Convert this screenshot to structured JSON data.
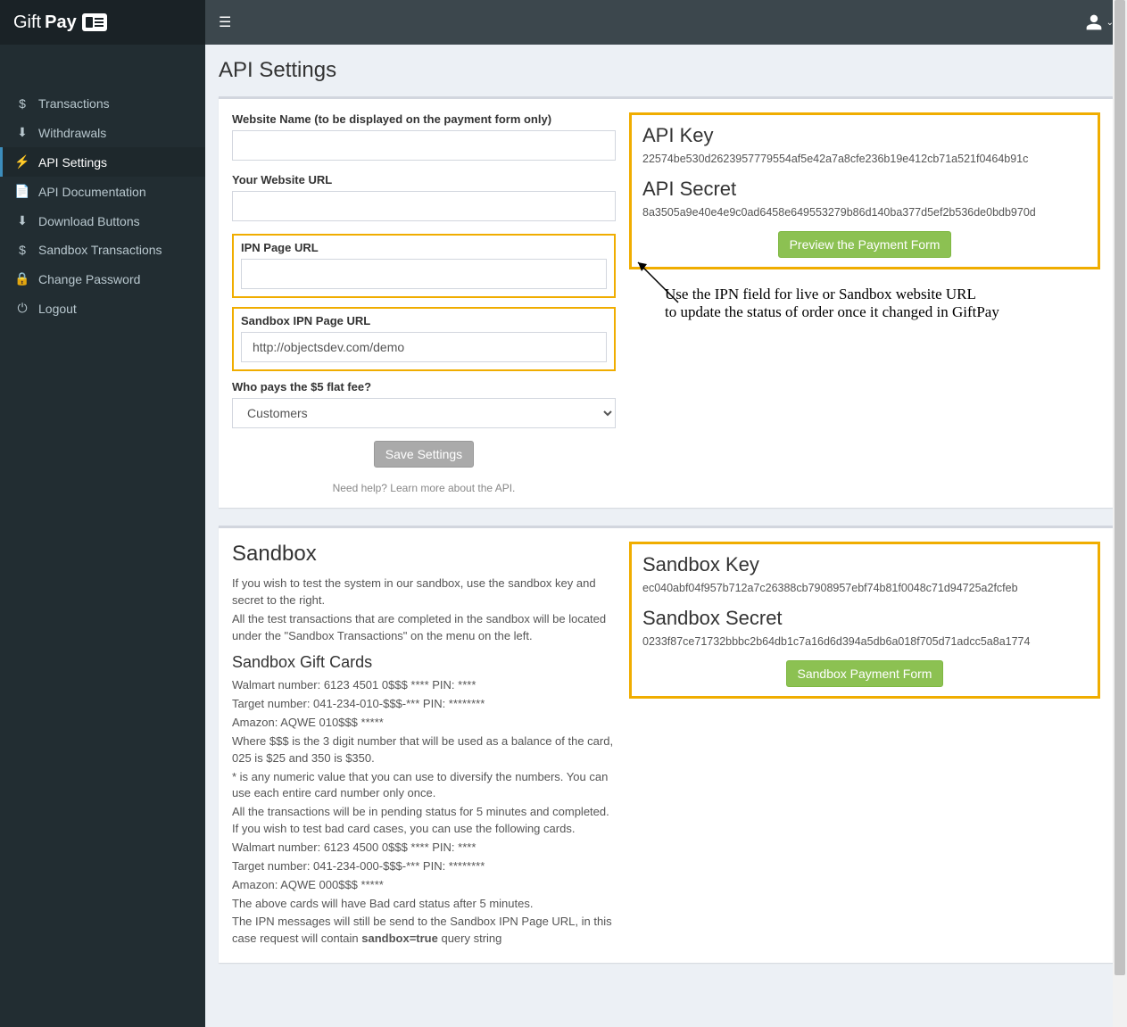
{
  "brand": {
    "part1": "Gift",
    "part2": "Pay"
  },
  "sidebar": {
    "items": [
      {
        "icon": "$",
        "label": "Transactions"
      },
      {
        "icon": "⬇",
        "label": "Withdrawals"
      },
      {
        "icon": "⚡",
        "label": "API Settings"
      },
      {
        "icon": "📄",
        "label": "API Documentation"
      },
      {
        "icon": "⬇",
        "label": "Download Buttons"
      },
      {
        "icon": "$",
        "label": "Sandbox Transactions"
      },
      {
        "icon": "🔒",
        "label": "Change Password"
      },
      {
        "icon": "⏻",
        "label": "Logout"
      }
    ]
  },
  "page": {
    "title": "API Settings"
  },
  "form": {
    "website_name_label": "Website Name (to be displayed on the payment form only)",
    "website_name_value": "",
    "website_url_label": "Your Website URL",
    "website_url_value": "",
    "ipn_label": "IPN Page URL",
    "ipn_value": "",
    "sandbox_ipn_label": "Sandbox IPN Page URL",
    "sandbox_ipn_value": "http://objectsdev.com/demo",
    "fee_label": "Who pays the $5 flat fee?",
    "fee_value": "Customers",
    "save_label": "Save Settings",
    "help_text": "Need help? Learn more about the ",
    "help_link": "API."
  },
  "api": {
    "key_heading": "API Key",
    "key_value": "22574be530d2623957779554af5e42a7a8cfe236b19e412cb71a521f0464b91c",
    "secret_heading": "API Secret",
    "secret_value": "8a3505a9e40e4e9c0ad6458e649553279b86d140ba377d5ef2b536de0bdb970d",
    "preview_btn": "Preview the Payment Form"
  },
  "annotation": {
    "line1": "Use the IPN field for live or Sandbox website URL",
    "line2": "to update the status of order once it changed in GiftPay"
  },
  "sandbox": {
    "heading": "Sandbox",
    "intro1": "If you wish to test the system in our sandbox, use the sandbox key and secret to the right.",
    "intro2": "All the test transactions that are completed in the sandbox will be located under the \"Sandbox Transactions\" on the menu on the left.",
    "cards_heading": "Sandbox Gift Cards",
    "l1": "Walmart number: 6123 4501 0$$$ **** PIN: ****",
    "l2": "Target number: 041-234-010-$$$-*** PIN: ********",
    "l3": "Amazon: AQWE 010$$$ *****",
    "l4": "Where $$$ is the 3 digit number that will be used as a balance of the card, 025 is $25 and 350 is $350.",
    "l5": "* is any numeric value that you can use to diversify the numbers. You can use each entire card number only once.",
    "l6": "All the transactions will be in pending status for 5 minutes and completed. If you wish to test bad card cases, you can use the following cards.",
    "l7": "Walmart number: 6123 4500 0$$$ **** PIN: ****",
    "l8": "Target number: 041-234-000-$$$-*** PIN: ********",
    "l9": "Amazon: AQWE 000$$$ *****",
    "l10": "The above cards will have Bad card status after 5 minutes.",
    "l11a": "The IPN messages will still be send to the Sandbox IPN Page URL, in this case request will contain ",
    "l11b": "sandbox=true",
    "l11c": " query string",
    "key_heading": "Sandbox Key",
    "key_value": "ec040abf04f957b712a7c26388cb7908957ebf74b81f0048c71d94725a2fcfeb",
    "secret_heading": "Sandbox Secret",
    "secret_value": "0233f87ce71732bbbc2b64db1c7a16d6d394a5db6a018f705d71adcc5a8a1774",
    "form_btn": "Sandbox Payment Form"
  }
}
